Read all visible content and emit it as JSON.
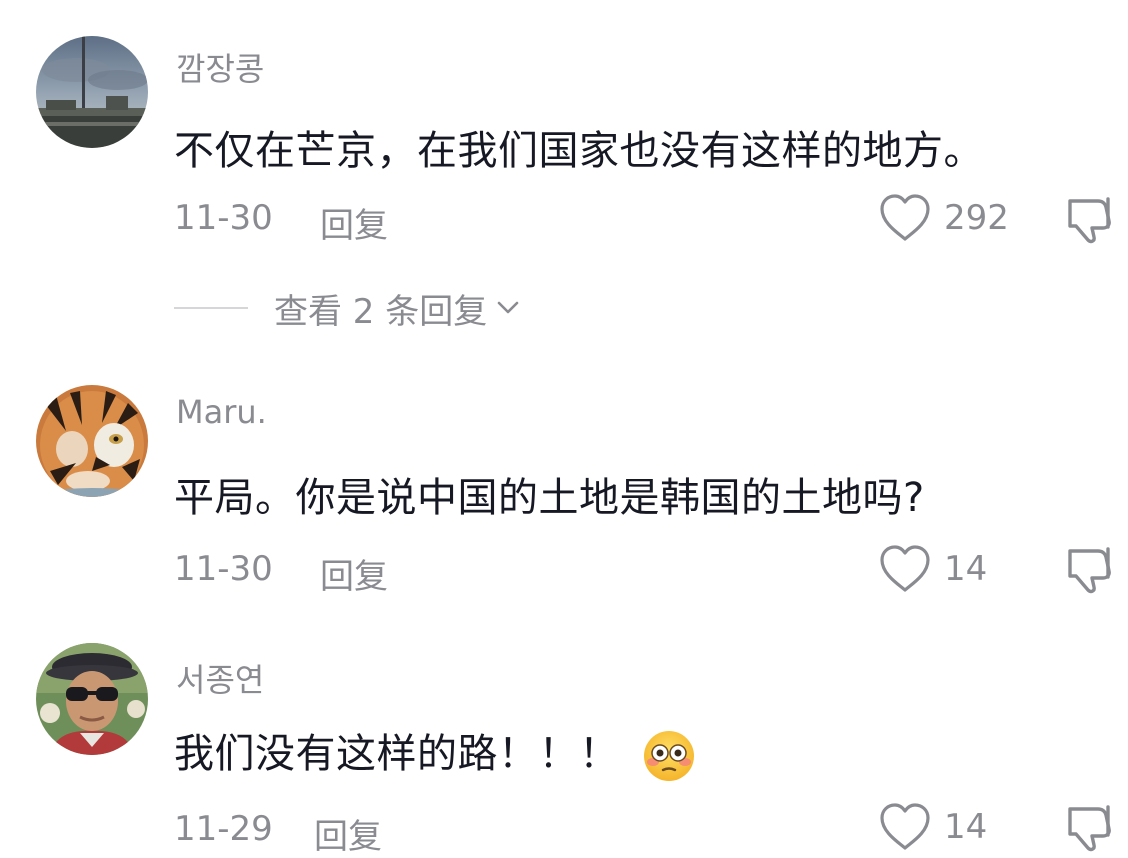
{
  "comments": [
    {
      "username": "깜장콩",
      "text": "不仅在芒京，在我们国家也没有这样的地方。",
      "date": "11-30",
      "reply_label": "回复",
      "likes": "292",
      "view_replies": "查看 2 条回复",
      "avatar": "avatar-seaside-photo"
    },
    {
      "username": "Maru.",
      "text": "平局。你是说中国的土地是韩国的土地吗?",
      "date": "11-30",
      "reply_label": "回复",
      "likes": "14",
      "avatar": "avatar-tiger-photo"
    },
    {
      "username": "서종연",
      "text": "我们没有这样的路！！！",
      "emoji": "flushed-face-emoji",
      "date": "11-29",
      "reply_label": "回复",
      "likes": "14",
      "avatar": "avatar-man-sunglasses-photo"
    }
  ],
  "icons": {
    "like": "heart-outline-icon",
    "dislike": "thumbs-down-icon",
    "expand": "chevron-down-icon"
  },
  "colors": {
    "text_primary": "#161823",
    "text_secondary": "#8a8b91"
  }
}
